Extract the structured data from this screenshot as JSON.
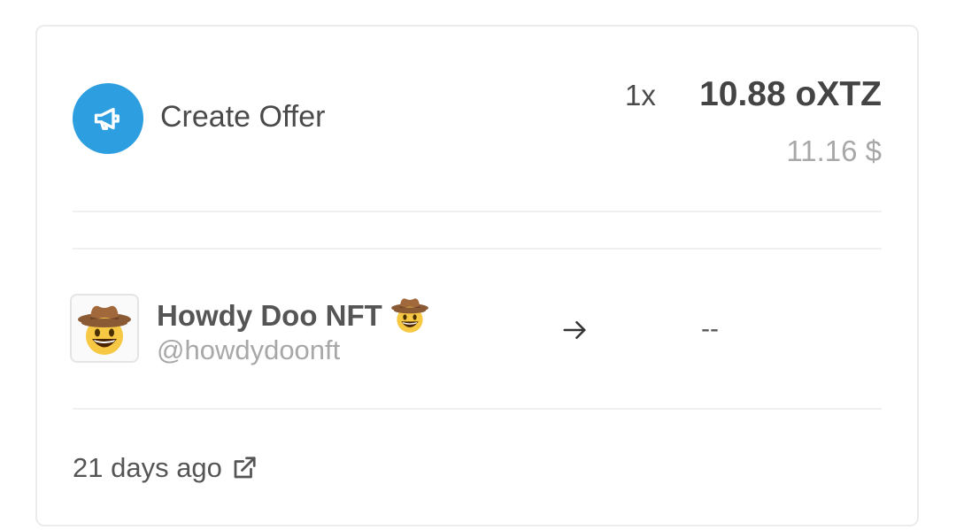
{
  "event": {
    "action_icon": "megaphone-icon",
    "action_label": "Create Offer",
    "quantity": "1x",
    "price": "10.88 oXTZ",
    "usd_price": "11.16 $",
    "accent_color": "#2d9ee0"
  },
  "from_user": {
    "name": "Howdy Doo NFT",
    "handle": "@howdydoonft",
    "avatar_icon": "cowboy-face-emoji",
    "name_emoji": "cowboy-face-emoji"
  },
  "transfer": {
    "arrow_icon": "arrow-right-icon",
    "recipient": "--"
  },
  "timestamp": {
    "text": "21 days ago",
    "link_icon": "external-link-icon"
  }
}
